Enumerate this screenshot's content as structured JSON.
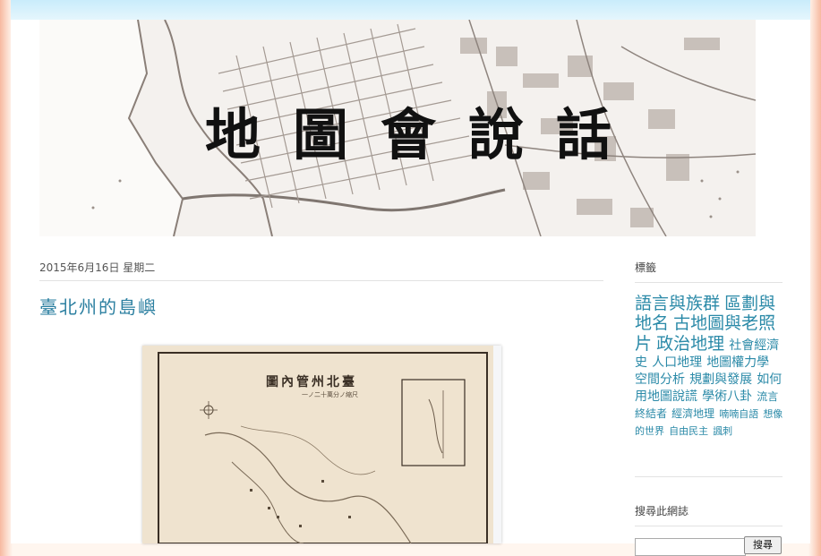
{
  "blog": {
    "title": "地圖會說話"
  },
  "post": {
    "date_header": "2015年6月16日 星期二",
    "title": "臺北州的島嶼",
    "image_title": "圖內管州北臺",
    "image_subtitle": "一ノ二十萬分ノ縮尺"
  },
  "sidebar": {
    "labels_heading": "標籤",
    "labels": [
      {
        "text": "語言與族群",
        "size": "s1"
      },
      {
        "text": "區劃與地名",
        "size": "s1"
      },
      {
        "text": "古地圖與老照片",
        "size": "s1"
      },
      {
        "text": "政治地理",
        "size": "s1"
      },
      {
        "text": "社會經濟史",
        "size": "s2"
      },
      {
        "text": "人口地理",
        "size": "s2"
      },
      {
        "text": "地圖權力學",
        "size": "s2"
      },
      {
        "text": "空間分析",
        "size": "s2"
      },
      {
        "text": "規劃與發展",
        "size": "s2"
      },
      {
        "text": "如何用地圖說謊",
        "size": "s2"
      },
      {
        "text": "學術八卦",
        "size": "s2"
      },
      {
        "text": "流言終結者",
        "size": "s3"
      },
      {
        "text": "經濟地理",
        "size": "s3"
      },
      {
        "text": "喃喃自語",
        "size": "s4"
      },
      {
        "text": "想像的世界",
        "size": "s4"
      },
      {
        "text": "自由民主",
        "size": "s4"
      },
      {
        "text": "諷刺",
        "size": "s4"
      }
    ],
    "search_heading": "搜尋此網誌",
    "search_button": "搜尋",
    "search_placeholder": ""
  },
  "colors": {
    "link": "#2b8aa8",
    "title": "#2b7fa0",
    "page_edge": "#f7b9a0"
  }
}
